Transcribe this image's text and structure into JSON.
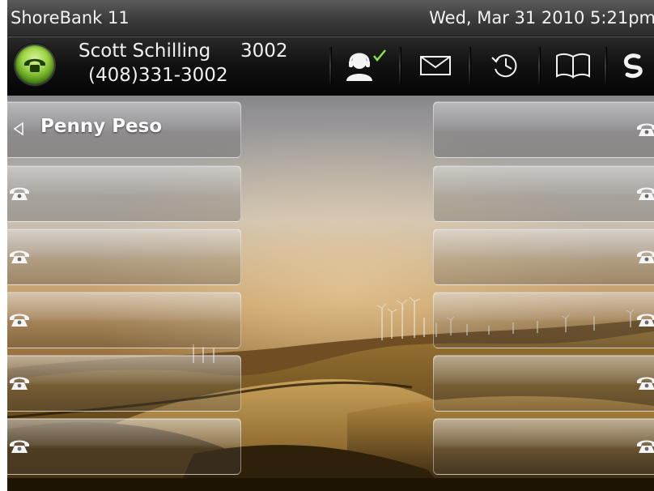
{
  "status_bar": {
    "title": "ShoreBank 11",
    "datetime": "Wed, Mar 31 2010 5:21pm"
  },
  "caller": {
    "name": "Scott Schilling",
    "extension": "3002",
    "number": "(408)331-3002",
    "line_button_icon": "handset-icon",
    "presence": "available"
  },
  "toolbar": {
    "icons": [
      "presence-agent-icon",
      "voicemail-envelope-icon",
      "history-clock-icon",
      "directory-book-icon",
      "shoretel-logo-icon"
    ]
  },
  "line_keys": {
    "left": [
      {
        "label": "Penny Peso",
        "icon": "left-arrow-icon"
      },
      {
        "label": "",
        "icon": "phone-icon"
      },
      {
        "label": "",
        "icon": "phone-icon"
      },
      {
        "label": "",
        "icon": "phone-icon"
      },
      {
        "label": "",
        "icon": "phone-icon"
      },
      {
        "label": "",
        "icon": "phone-icon"
      }
    ],
    "right": [
      {
        "label": "",
        "icon": "phone-icon"
      },
      {
        "label": "",
        "icon": "phone-icon"
      },
      {
        "label": "",
        "icon": "phone-icon"
      },
      {
        "label": "",
        "icon": "phone-icon"
      },
      {
        "label": "",
        "icon": "phone-icon"
      },
      {
        "label": "",
        "icon": "phone-icon"
      }
    ]
  },
  "colors": {
    "line_button_green": "#7cc832",
    "presence_check": "#8be04e",
    "bar_background": "#0a0a0a"
  }
}
